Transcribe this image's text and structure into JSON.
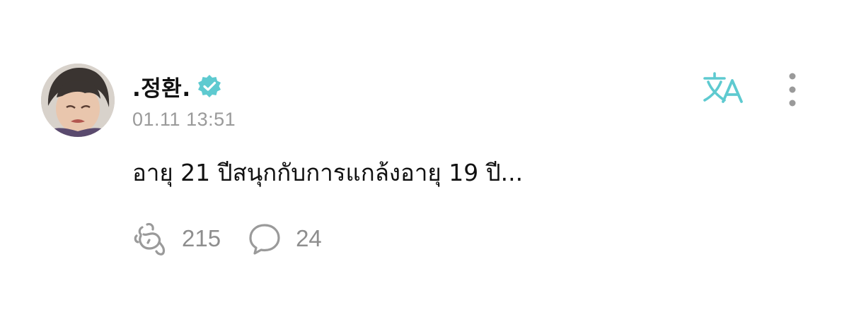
{
  "post": {
    "author": {
      "name": ".정환.",
      "verified": true,
      "verified_color": "#5ecad0",
      "avatar_icon": "avatar-photo"
    },
    "timestamp": "01.11 13:51",
    "text": "อายุ 21 ปีสนุกกับการแกล้งอายุ 19 ปี...",
    "translate_icon": "translate-icon",
    "more_icon": "more-vertical-icon",
    "reactions": {
      "like_icon": "paw-like-icon",
      "like_count": "215",
      "comment_icon": "comment-bubble-icon",
      "comment_count": "24"
    }
  },
  "colors": {
    "accent": "#5ecad0",
    "text": "#111111",
    "muted": "#9a9a9a",
    "icon_gray": "#999999"
  }
}
